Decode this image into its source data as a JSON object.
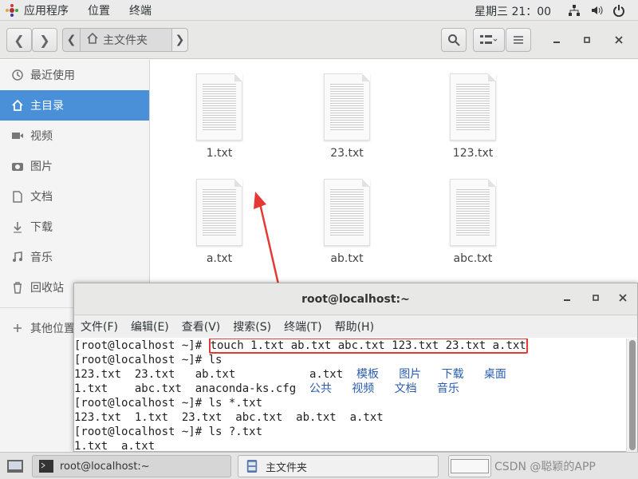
{
  "topbar": {
    "menus": [
      "应用程序",
      "位置",
      "终端"
    ],
    "clock": "星期三 21：00"
  },
  "file_manager": {
    "location": "主文件夹",
    "sidebar": [
      {
        "label": "最近使用",
        "icon": "clock-icon"
      },
      {
        "label": "主目录",
        "icon": "home-icon",
        "active": true
      },
      {
        "label": "视频",
        "icon": "video-icon"
      },
      {
        "label": "图片",
        "icon": "camera-icon"
      },
      {
        "label": "文档",
        "icon": "document-icon"
      },
      {
        "label": "下载",
        "icon": "download-icon"
      },
      {
        "label": "音乐",
        "icon": "music-icon"
      },
      {
        "label": "回收站",
        "icon": "trash-icon"
      },
      {
        "label": "其他位置",
        "icon": "plus-icon"
      }
    ],
    "files": [
      "1.txt",
      "23.txt",
      "123.txt",
      "a.txt",
      "ab.txt",
      "abc.txt"
    ]
  },
  "terminal": {
    "title": "root@localhost:~",
    "menus": [
      "文件(F)",
      "编辑(E)",
      "查看(V)",
      "搜索(S)",
      "终端(T)",
      "帮助(H)"
    ],
    "lines": {
      "l1_prompt": "[root@localhost ~]# ",
      "l1_cmd": "touch 1.txt ab.txt abc.txt 123.txt 23.txt a.txt",
      "l2": "[root@localhost ~]# ls",
      "l3_plain": "123.txt  23.txt   ab.txt           a.txt  ",
      "l3_dirs": "模板   图片   下载   桌面",
      "l4_plain": "1.txt    abc.txt  anaconda-ks.cfg  ",
      "l4_dirs": "公共   视频   文档   音乐",
      "l5": "[root@localhost ~]# ls *.txt",
      "l6": "123.txt  1.txt  23.txt  abc.txt  ab.txt  a.txt",
      "l7": "[root@localhost ~]# ls ?.txt",
      "l8": "1.txt  a.txt"
    }
  },
  "taskbar": {
    "tasks": [
      "root@localhost:~",
      "主文件夹"
    ],
    "watermark": "CSDN @聪颖的APP"
  },
  "colors": {
    "accent": "#4a90d9",
    "highlight_box": "#e53935",
    "dir_blue": "#2a5db0"
  }
}
